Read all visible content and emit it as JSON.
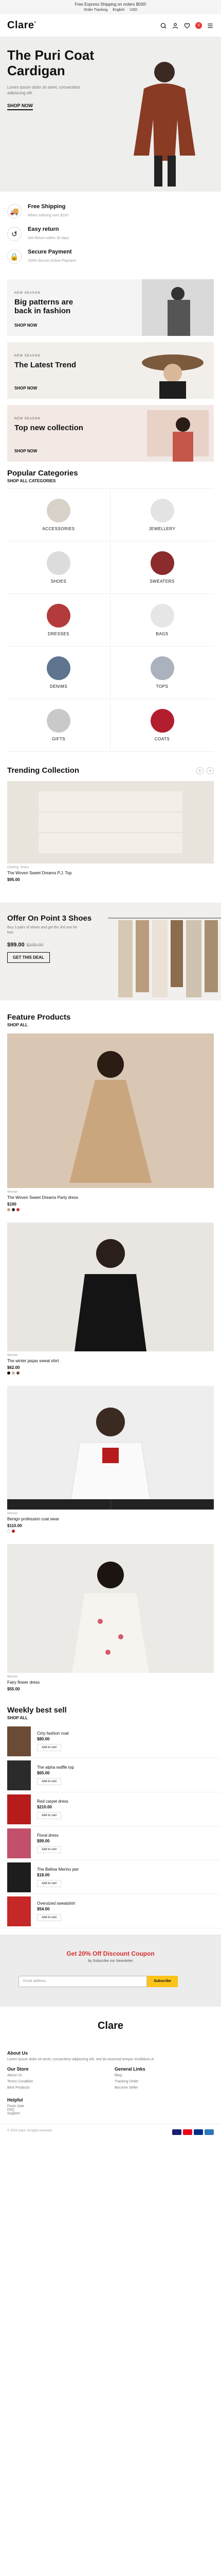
{
  "topbar": {
    "text": "Free Express Shipping on orders $500!",
    "links": [
      "Order Tracking",
      "English",
      "USD"
    ]
  },
  "header": {
    "logo": "Clare",
    "logo_mark": "°",
    "cart_count": "0"
  },
  "hero": {
    "title": "The Puri Coat Cardigan",
    "desc": "Lorem ipsum dolor sit amet, consectetur adipiscing elit.",
    "cta": "SHOP NOW"
  },
  "features": [
    {
      "icon": "truck-icon",
      "glyph": "🚚",
      "title": "Free Shipping",
      "sub": "When ordering over $100"
    },
    {
      "icon": "return-icon",
      "glyph": "↺",
      "title": "Easy return",
      "sub": "Get Return within 30 days"
    },
    {
      "icon": "lock-icon",
      "glyph": "🔒",
      "title": "Secure Payment",
      "sub": "100% Secure Online Payment"
    }
  ],
  "banners": [
    {
      "tag": "NEW SEASON",
      "title": "Big patterns are back in fashion",
      "link": "SHOP NOW",
      "bg": "#f4f4f4"
    },
    {
      "tag": "NEW SEASON",
      "title": "The Latest Trend",
      "link": "SHOP NOW",
      "bg": "#f2efeb"
    },
    {
      "tag": "NEW SEASON",
      "title": "Top new collection",
      "link": "SHOP NOW",
      "bg": "#f2e8e4"
    }
  ],
  "categories": {
    "title": "Popular Categories",
    "shop_all": "SHOP ALL CATEGORIES",
    "items": [
      "ACCESSORIES",
      "JEWELLERY",
      "SHOES",
      "SWEATERS",
      "DRESSES",
      "BAGS",
      "DENIMS",
      "TOPS",
      "GIFTS",
      "COATS"
    ]
  },
  "trending": {
    "title": "Trending Collection",
    "meta": "Clothing, Shoes",
    "name": "The Woven Sweet Dreams P.J. Top",
    "price": "$95.00"
  },
  "offer": {
    "title": "Offer On Point 3 Shoes",
    "desc": "Buy 3 pairs of shoes and get the 3rd one for free",
    "price": "$99.00",
    "old_price": "$109.00",
    "cta": "GET THIS DEAL"
  },
  "featured": {
    "title": "Feature Products",
    "shop_all": "SHOP ALL",
    "products": [
      {
        "meta": "Women",
        "name": "The Woven Sweet Dreams Party dress",
        "price": "$190"
      },
      {
        "meta": "Women",
        "name": "The winter jasjas sweat shirt",
        "price": "$62.00"
      },
      {
        "meta": "Women",
        "name": "Benign profession coat wear",
        "price": "$110.00"
      },
      {
        "meta": "Women",
        "name": "Fairy flower dress",
        "price": "$55.00"
      }
    ]
  },
  "bestsell": {
    "title": "Weekly best sell",
    "shop_all": "SHOP ALL",
    "add": "Add to cart",
    "items": [
      {
        "name": "Cirty fashion coat",
        "price": "$80.00"
      },
      {
        "name": "The alpha waffle top",
        "price": "$65.00"
      },
      {
        "name": "Red carpet dress",
        "price": "$210.00"
      },
      {
        "name": "Floral dress",
        "price": "$99.00"
      },
      {
        "name": "The Bellow Merino pwr",
        "price": "$18.00"
      },
      {
        "name": "Oversized sweatshirt",
        "price": "$54.00"
      }
    ]
  },
  "newsletter": {
    "title": "Get 20% Off Discount Coupon",
    "sub": "by Subscribe our Newsletter",
    "placeholder": "Email address",
    "button": "Subscribe"
  },
  "footer": {
    "logo": "Clare",
    "about_title": "About Us",
    "about": "Lorem ipsum dolor sit amet, consectetur adipiscing elit, sed do eiusmod tempor incididunt ut.",
    "col1_title": "Our Store",
    "col1": [
      "About Us",
      "Terms Condition",
      "Best Products"
    ],
    "col2_title": "General Links",
    "col2": [
      "Blog",
      "Tracking Order",
      "Become Seller"
    ],
    "help_title": "Helpful",
    "help": [
      "Flash Sale",
      "FAQ",
      "Support"
    ],
    "copyright": "© 2023 Clare. All rights reserved"
  },
  "colors": {
    "accent": "#fcc419",
    "sale": "#d32f2f"
  }
}
